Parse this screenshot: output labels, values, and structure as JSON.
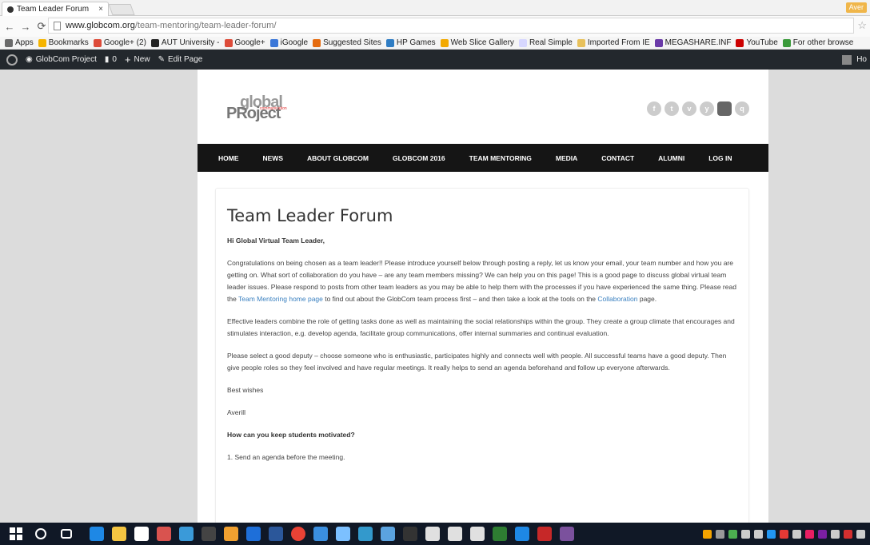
{
  "browser": {
    "tab_title": "Team Leader Forum",
    "tab_close": "×",
    "user_chip": "Aver",
    "url_domain": "www.globcom.org",
    "url_path": "/team-mentoring/team-leader-forum/",
    "bookmarks": [
      {
        "label": "Apps",
        "color": "#6a6a6a"
      },
      {
        "label": "Bookmarks",
        "color": "#f5b400"
      },
      {
        "label": "Google+ (2)",
        "color": "#dd4b39"
      },
      {
        "label": "AUT University -",
        "color": "#222222"
      },
      {
        "label": "Google+",
        "color": "#dd4b39"
      },
      {
        "label": "iGoogle",
        "color": "#3b77d8"
      },
      {
        "label": "Suggested Sites",
        "color": "#e56b0f"
      },
      {
        "label": "HP Games",
        "color": "#2f7dc4"
      },
      {
        "label": "Web Slice Gallery",
        "color": "#f2a900"
      },
      {
        "label": "Real Simple",
        "color": "#d7d7ff"
      },
      {
        "label": "Imported From IE",
        "color": "#e8c15b"
      },
      {
        "label": "MEGASHARE.INF",
        "color": "#6a3aa8"
      },
      {
        "label": "YouTube",
        "color": "#cc0000"
      },
      {
        "label": "For other browse",
        "color": "#3a9a3a"
      }
    ]
  },
  "adminbar": {
    "site_name": "GlobCom Project",
    "comments": "0",
    "new_label": "New",
    "edit_label": "Edit Page",
    "howdy": "Ho"
  },
  "site": {
    "logo_top": "global",
    "logo_bottom": "PRoject",
    "logo_small": "communication",
    "social": [
      "f",
      "t",
      "v",
      "y",
      "",
      "q"
    ],
    "nav": [
      "HOME",
      "NEWS",
      "ABOUT GLOBCOM",
      "GLOBCOM 2016",
      "TEAM MENTORING",
      "MEDIA",
      "CONTACT",
      "ALUMNI",
      "LOG IN"
    ]
  },
  "article": {
    "title": "Team Leader Forum",
    "greeting": "Hi Global Virtual Team Leader,",
    "p1_a": "Congratulations on being chosen as a team leader!! Please introduce yourself below through posting a reply, let us know your email, your team number and how you are getting on. What sort of collaboration do you have – are any team members missing? We can help you on this page! This is a good page to discuss global virtual team leader issues. Please respond to posts from other team leaders as you may be able to help them with the processes if you have experienced the same thing. Please read the ",
    "p1_link1": "Team Mentoring home page",
    "p1_b": " to find out about the GlobCom team process first – and then take a look at the tools on the ",
    "p1_link2": "Collaboration",
    "p1_c": " page.",
    "p2": "Effective leaders combine the role of getting tasks done as well as maintaining the social relationships within the group. They create a group climate that encourages and stimulates interaction, e.g. develop agenda, facilitate group communications, offer internal summaries and continual evaluation.",
    "p3": "Please select a good deputy – choose someone who is enthusiastic, participates highly and connects well with people. All successful teams have a good deputy. Then give people roles so they feel involved and have regular meetings. It really helps to send an agenda beforehand and follow up everyone afterwards.",
    "signoff": "Best wishes",
    "author": "Averill",
    "subheading": "How can you keep students motivated?",
    "item1": "1. Send an agenda before the meeting."
  }
}
